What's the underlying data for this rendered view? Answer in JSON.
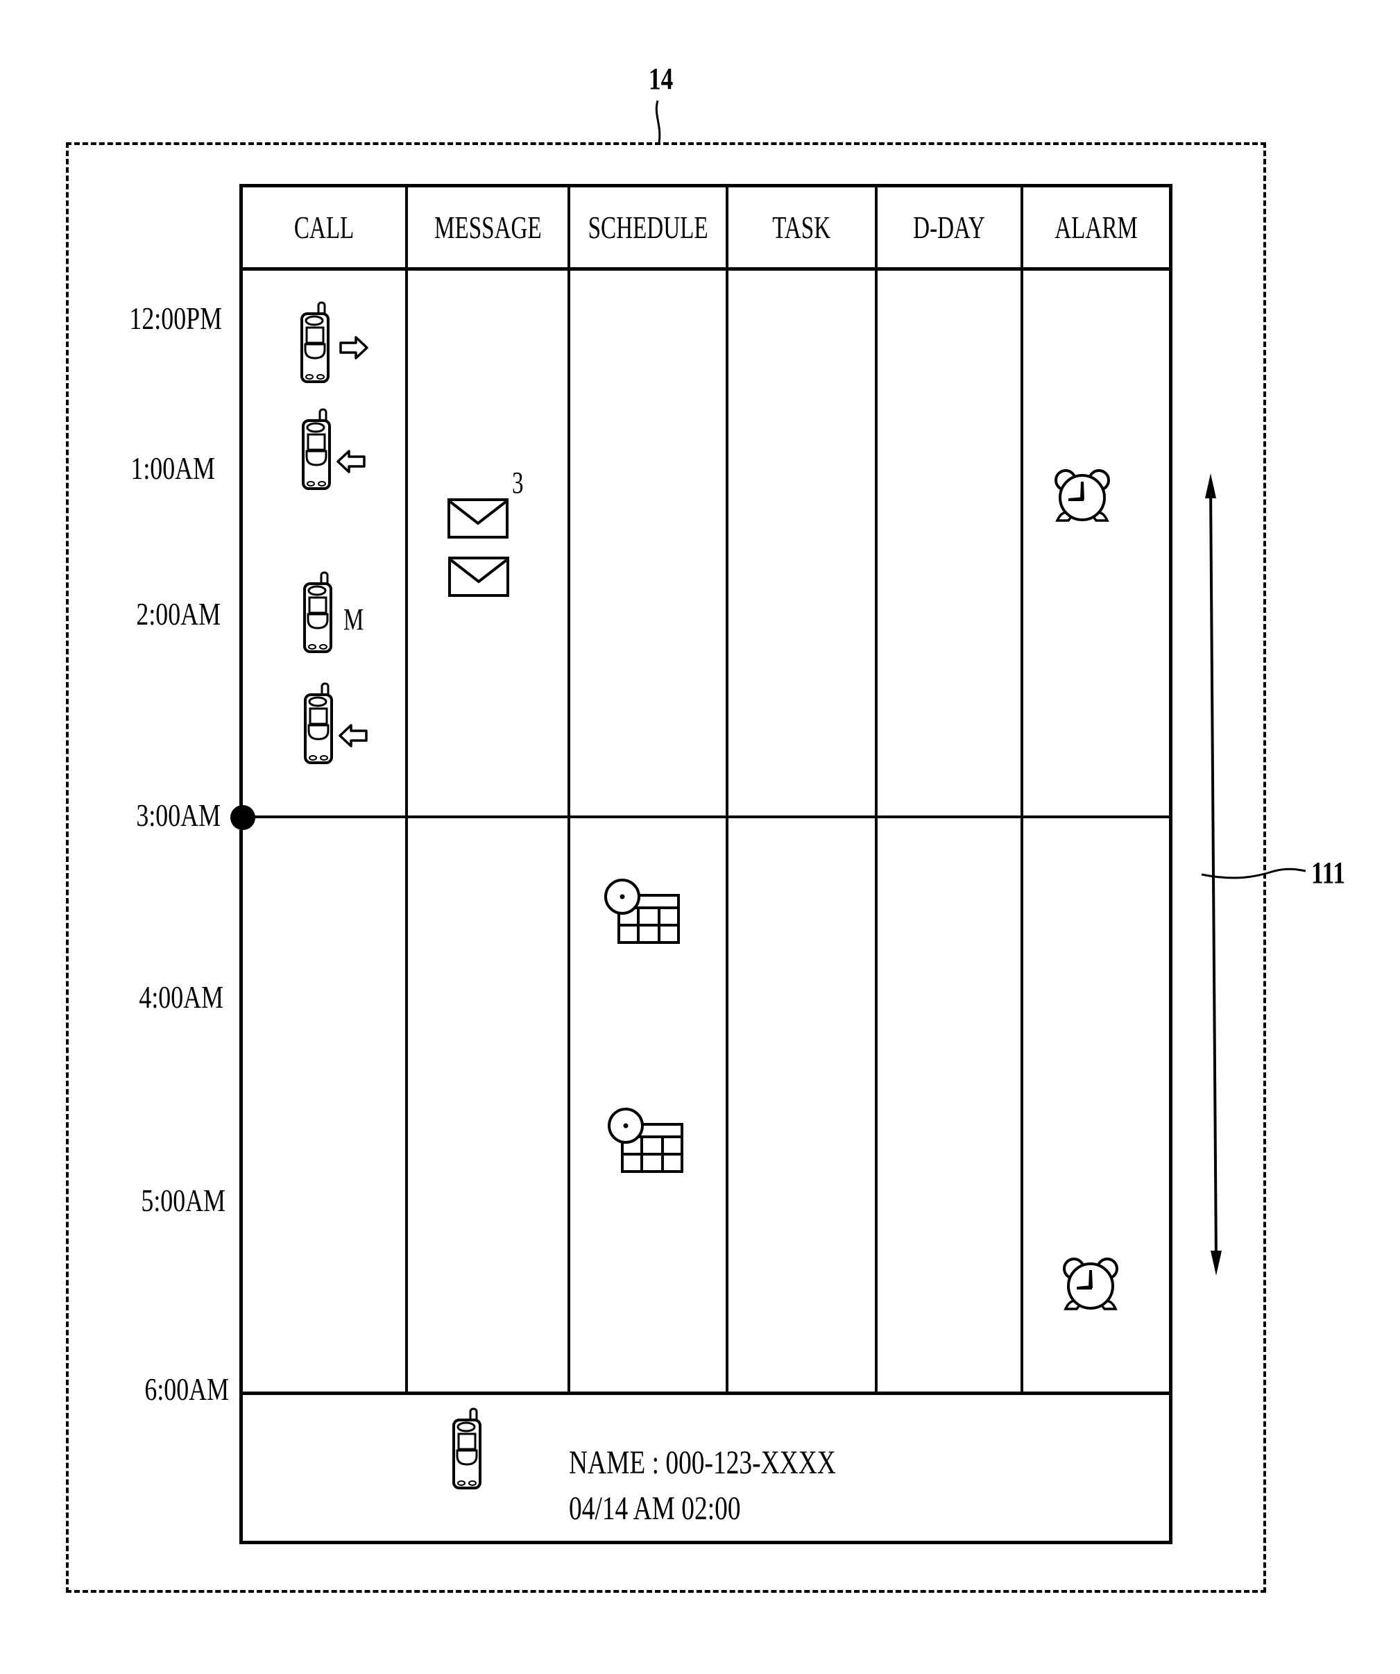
{
  "figure": {
    "frame_ref": "14",
    "scroll_ref": "111"
  },
  "columns": [
    {
      "label": "CALL"
    },
    {
      "label": "MESSAGE"
    },
    {
      "label": "SCHEDULE"
    },
    {
      "label": "TASK"
    },
    {
      "label": "D-DAY"
    },
    {
      "label": "ALARM"
    }
  ],
  "time_axis": [
    {
      "label": "12:00PM"
    },
    {
      "label": "1:00AM"
    },
    {
      "label": "2:00AM"
    },
    {
      "label": "3:00AM"
    },
    {
      "label": "4:00AM"
    },
    {
      "label": "5:00AM"
    },
    {
      "label": "6:00AM"
    }
  ],
  "current_marker": {
    "time": "3:00AM"
  },
  "events": {
    "call": [
      {
        "icon": "phone-icon",
        "indicator": "outgoing-arrow-icon",
        "text": ""
      },
      {
        "icon": "phone-icon",
        "indicator": "incoming-arrow-icon",
        "text": ""
      },
      {
        "icon": "phone-icon",
        "indicator": "missed-call-mark",
        "text": "M"
      },
      {
        "icon": "phone-icon",
        "indicator": "incoming-arrow-icon",
        "text": ""
      }
    ],
    "message": [
      {
        "icon": "envelope-icon",
        "count": "3"
      },
      {
        "icon": "envelope-icon",
        "count": ""
      }
    ],
    "schedule": [
      {
        "icon": "schedule-calendar-icon"
      },
      {
        "icon": "schedule-calendar-icon"
      }
    ],
    "alarm": [
      {
        "icon": "alarm-clock-icon"
      },
      {
        "icon": "alarm-clock-icon"
      }
    ]
  },
  "detail": {
    "icon": "phone-icon",
    "line1": "NAME :  000-123-XXXX",
    "line2": "04/14  AM  02:00"
  }
}
